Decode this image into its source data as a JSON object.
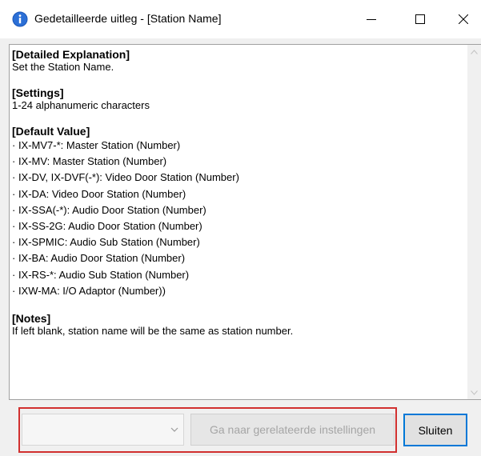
{
  "window": {
    "title": "Gedetailleerde uitleg - [Station Name]",
    "accent_color": "#0078d7"
  },
  "sections": {
    "detailed": {
      "heading": "[Detailed Explanation]",
      "body": "Set the Station Name."
    },
    "settings": {
      "heading": "[Settings]",
      "body": "1-24 alphanumeric characters"
    },
    "default": {
      "heading": "[Default Value]",
      "items": [
        "· IX-MV7-*: Master Station (Number)",
        "· IX-MV: Master Station (Number)",
        "· IX-DV, IX-DVF(-*): Video Door Station (Number)",
        "· IX-DA: Video Door Station (Number)",
        "· IX-SSA(-*): Audio Door Station (Number)",
        "· IX-SS-2G: Audio Door Station (Number)",
        "· IX-SPMIC: Audio Sub Station (Number)",
        "· IX-BA: Audio Door Station (Number)",
        "· IX-RS-*: Audio Sub Station (Number)",
        "· IXW-MA: I/O Adaptor (Number))"
      ]
    },
    "notes": {
      "heading": "[Notes]",
      "body": "If left blank, station name will be the same as station number."
    }
  },
  "footer": {
    "combo_value": "",
    "goto_label": "Ga naar gerelateerde instellingen",
    "close_label": "Sluiten",
    "highlight_color": "#d1302f"
  }
}
